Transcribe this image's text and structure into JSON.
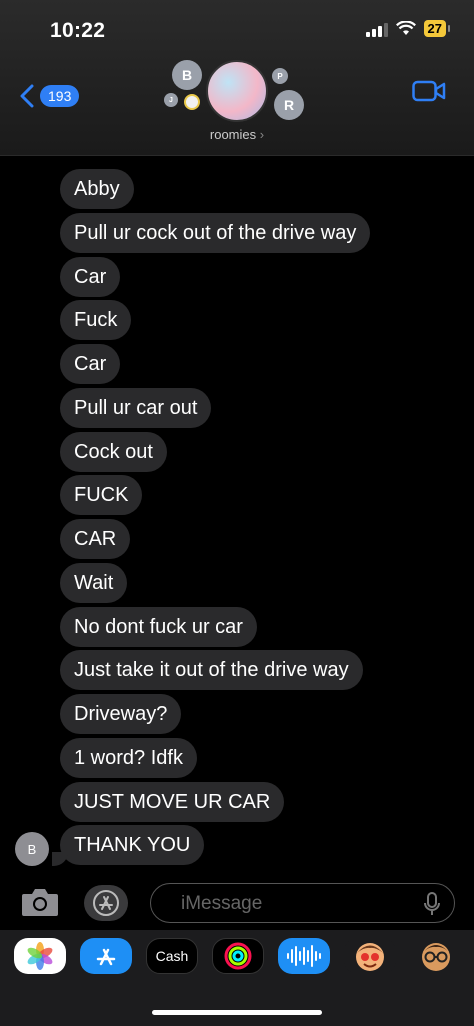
{
  "status_bar": {
    "time": "10:22",
    "battery": "27"
  },
  "header": {
    "back_count": "193",
    "group_name": "roomies",
    "chevron": "›",
    "avatar_initials": [
      "B",
      "P",
      "R",
      "J"
    ]
  },
  "messages": [
    "Abby",
    "Pull ur cock out of the drive way",
    "Car",
    "Fuck",
    "Car",
    "Pull ur car out",
    "Cock out",
    "FUCK",
    "CAR",
    "Wait",
    "No dont fuck ur car",
    "Just take it out of the drive way",
    "Driveway?",
    "1 word? Idfk",
    "JUST MOVE UR CAR",
    "THANK YOU"
  ],
  "sender_initial": "B",
  "input": {
    "placeholder": "iMessage"
  },
  "app_drawer": {
    "cash_label": "Cash",
    "apple_symbol": ""
  },
  "colors": {
    "accent": "#2f7ff5",
    "bubble": "#2a2a2c",
    "battery": "#f4c83a"
  }
}
